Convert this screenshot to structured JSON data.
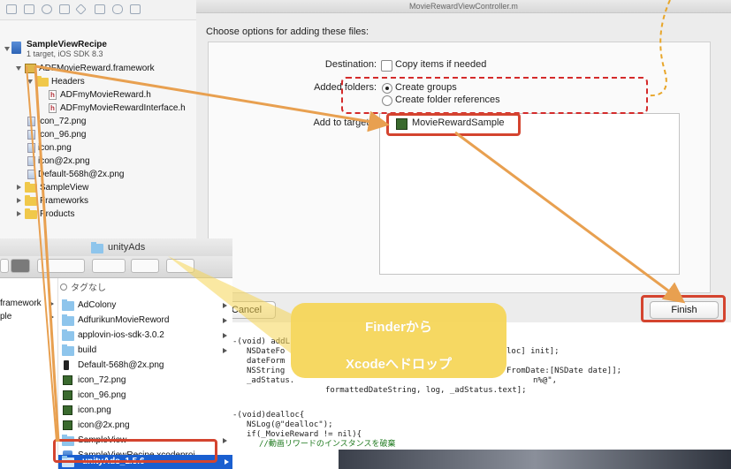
{
  "sheet_window_title": "MovieRewardViewController.m",
  "dialog": {
    "title": "Choose options for adding these files:",
    "destination_label": "Destination:",
    "copy_items_label": "Copy items if needed",
    "added_folders_label": "Added folders:",
    "create_groups_label": "Create groups",
    "create_folder_refs_label": "Create folder references",
    "add_to_targets_label": "Add to targets:",
    "target_item": "MovieRewardSample",
    "cancel_label": "Cancel",
    "finish_label": "Finish"
  },
  "navigator": {
    "project_name": "SampleViewRecipe",
    "project_subtitle": "1 target, iOS SDK 8.3",
    "items": [
      {
        "label": "ADFMovieReward.framework"
      },
      {
        "label": "Headers"
      },
      {
        "label": "ADFmyMovieReward.h"
      },
      {
        "label": "ADFmyMovieRewardInterface.h"
      },
      {
        "label": "icon_72.png"
      },
      {
        "label": "icon_96.png"
      },
      {
        "label": "icon.png"
      },
      {
        "label": "icon@2x.png"
      },
      {
        "label": "Default-568h@2x.png"
      },
      {
        "label": "SampleView"
      },
      {
        "label": "Frameworks"
      },
      {
        "label": "Products"
      }
    ]
  },
  "finder": {
    "window_title": "unityAds",
    "col1": [
      "framework",
      "ple"
    ],
    "col2_header": "タグなし",
    "items": [
      {
        "label": "AdColony",
        "type": "folder"
      },
      {
        "label": "AdfurikunMovieReword",
        "type": "folder"
      },
      {
        "label": "applovin-ios-sdk-3.0.2",
        "type": "folder"
      },
      {
        "label": "build",
        "type": "folder"
      },
      {
        "label": "Default-568h@2x.png",
        "type": "image"
      },
      {
        "label": "icon_72.png",
        "type": "image"
      },
      {
        "label": "icon_96.png",
        "type": "image"
      },
      {
        "label": "icon.png",
        "type": "image"
      },
      {
        "label": "icon@2x.png",
        "type": "image"
      },
      {
        "label": "SampleView",
        "type": "folder"
      },
      {
        "label": "SampleViewRecipe.xcodeproj",
        "type": "project"
      },
      {
        "label": "unityAds_1.5.6",
        "type": "folder",
        "selected": true
      }
    ]
  },
  "code": {
    "line1": "-(void) addL",
    "line2": "NSDateFo",
    "line2b": "loc] init];",
    "line3": "dateForm",
    "line4": "NSString",
    "line4b": "FromDate:[NSDate date]];",
    "line5": "_adStatus.",
    "line5b": "n%@\",",
    "line6": "formattedDateString, log, _adStatus.text];",
    "line7": "-(void)dealloc{",
    "line8": "NSLog(@\"dealloc\");",
    "line9": "if(_MovieReward != nil){",
    "line10": "//動画リワードのインスタンスを破棄"
  },
  "callout": {
    "line1": "Finderから",
    "line2": "Xcodeへドロップ"
  },
  "colors": {
    "accent_red": "#d4442f",
    "arrow_orange": "#e8a050",
    "callout_yellow": "#f5d555",
    "selection_blue": "#1a5fd0"
  }
}
